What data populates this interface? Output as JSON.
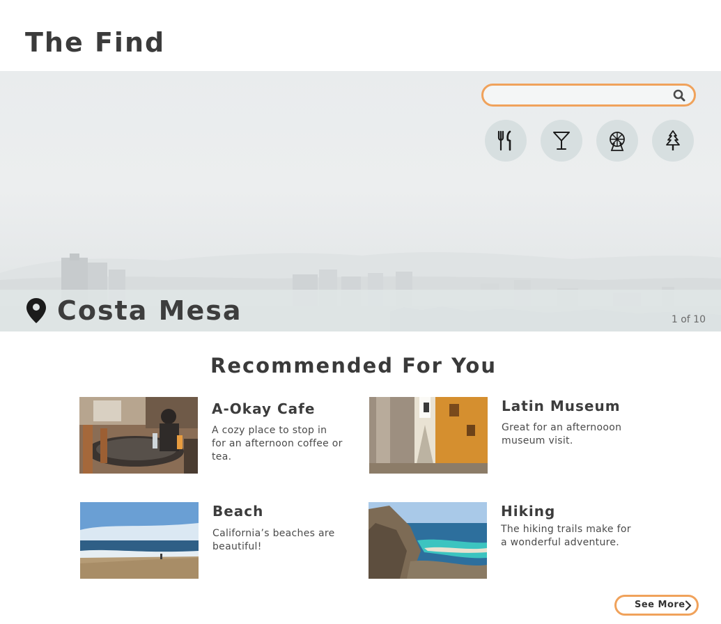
{
  "header": {
    "title": "The Find"
  },
  "search": {
    "placeholder": "",
    "value": ""
  },
  "categories": [
    {
      "name": "restaurants",
      "icon": "fork-knife-icon"
    },
    {
      "name": "bars",
      "icon": "cocktail-icon"
    },
    {
      "name": "attractions",
      "icon": "ferris-wheel-icon"
    },
    {
      "name": "outdoors",
      "icon": "pine-tree-icon"
    }
  ],
  "hero": {
    "location": "Costa Mesa",
    "counter": "1 of 10",
    "pin_icon": "location-pin-icon"
  },
  "recommendations": {
    "heading": "Recommended For You",
    "items": [
      {
        "title": "A-Okay Cafe",
        "description": "A cozy place to stop in for an afternoon coffee or tea."
      },
      {
        "title": "Latin Museum",
        "description": "Great for an afternooon museum visit."
      },
      {
        "title": "Beach",
        "description": "California’s beaches are beautiful!"
      },
      {
        "title": "Hiking",
        "description": "The hiking trails make for a wonderful adventure."
      }
    ],
    "see_more": "See More"
  },
  "colors": {
    "accent": "#f0a25b",
    "icon_bg": "#d7dfe0",
    "text": "#3a3a3a"
  }
}
